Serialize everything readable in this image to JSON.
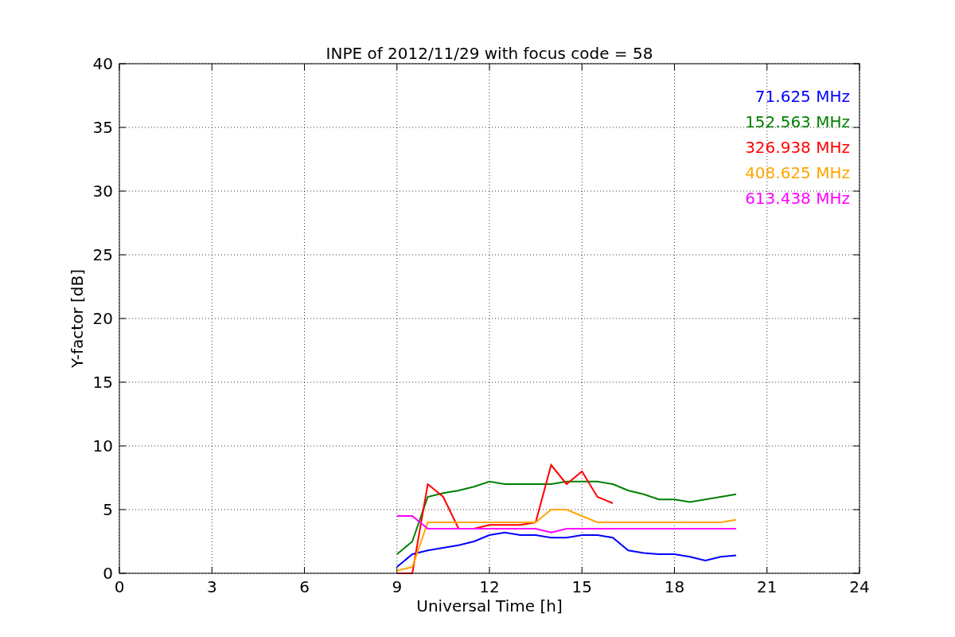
{
  "chart_data": {
    "type": "line",
    "title": "INPE of 2012/11/29 with focus code = 58",
    "xlabel": "Universal Time [h]",
    "ylabel": "Y-factor [dB]",
    "x": [
      9,
      9.5,
      10,
      10.5,
      11,
      11.5,
      12,
      12.5,
      13,
      13.5,
      14,
      14.5,
      15,
      15.5,
      16,
      16.5,
      17,
      17.5,
      18,
      18.5,
      19,
      19.5,
      20
    ],
    "series": [
      {
        "name": "71.625 MHz",
        "color": "#0000ff",
        "values": [
          0.5,
          1.5,
          1.8,
          2,
          2.2,
          2.5,
          3,
          3.2,
          3,
          3,
          2.8,
          2.8,
          3,
          3,
          2.8,
          1.8,
          1.6,
          1.5,
          1.5,
          1.3,
          1,
          1.3,
          1.4
        ]
      },
      {
        "name": "152.563 MHz",
        "color": "#008000",
        "values": [
          1.5,
          2.5,
          6,
          6.3,
          6.5,
          6.8,
          7.2,
          7,
          7,
          7,
          7,
          7.2,
          7.2,
          7.2,
          7,
          6.5,
          6.2,
          5.8,
          5.8,
          5.6,
          5.8,
          6,
          6.2
        ]
      },
      {
        "name": "326.938 MHz",
        "color": "#ff0000",
        "values": [
          0,
          0,
          7,
          6,
          3.5,
          3.5,
          3.8,
          3.8,
          3.8,
          4,
          8.5,
          7,
          8,
          6,
          5.5,
          null,
          null,
          null,
          null,
          null,
          null,
          null,
          null
        ]
      },
      {
        "name": "408.625 MHz",
        "color": "#ffa500",
        "values": [
          0.2,
          0.5,
          4,
          4,
          4,
          4,
          4,
          4,
          4,
          4,
          5,
          5,
          4.5,
          4,
          4,
          4,
          4,
          4,
          4,
          4,
          4,
          4,
          4.2
        ]
      },
      {
        "name": "613.438 MHz",
        "color": "#ff00ff",
        "values": [
          4.5,
          4.5,
          3.5,
          3.5,
          3.5,
          3.5,
          3.5,
          3.5,
          3.5,
          3.5,
          3.2,
          3.5,
          3.5,
          3.5,
          3.5,
          3.5,
          3.5,
          3.5,
          3.5,
          3.5,
          3.5,
          3.5,
          3.5
        ]
      }
    ],
    "xlim": [
      0,
      24
    ],
    "ylim": [
      0,
      40
    ],
    "xticks": [
      0,
      3,
      6,
      9,
      12,
      15,
      18,
      21,
      24
    ],
    "yticks": [
      0,
      5,
      10,
      15,
      20,
      25,
      30,
      35,
      40
    ],
    "grid": true
  }
}
